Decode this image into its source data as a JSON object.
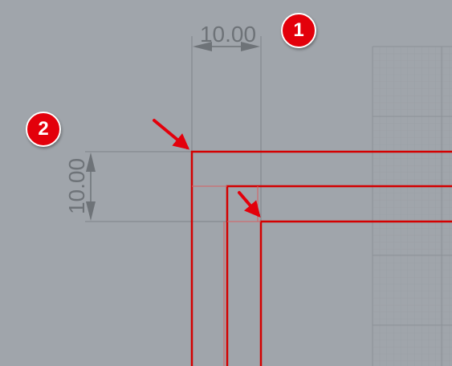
{
  "colors": {
    "background": "#a0a5ab",
    "grid": "#959aa0",
    "grid_major": "#8c9197",
    "dimension": "#6e7378",
    "outline": "#d40000",
    "badge": "#e3000b",
    "arrow": "#e3000b"
  },
  "dimensions": {
    "horizontal": {
      "text": "10.00"
    },
    "vertical": {
      "text": "10.00"
    }
  },
  "callouts": [
    {
      "label": "1"
    },
    {
      "label": "2"
    }
  ]
}
